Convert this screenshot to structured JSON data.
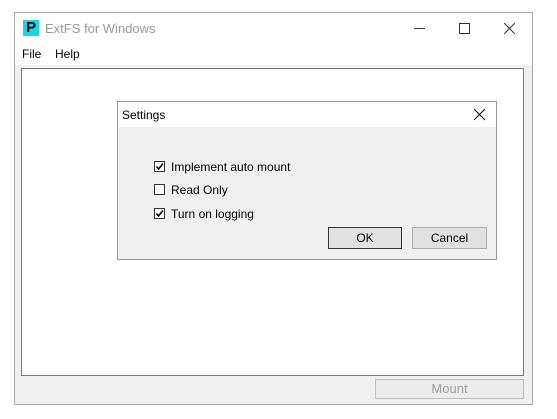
{
  "window": {
    "title": "ExtFS for Windows",
    "icon_glyph": "P",
    "icon_color": "#19d3e6"
  },
  "menu": {
    "file": "File",
    "help": "Help"
  },
  "dialog": {
    "title": "Settings",
    "options": [
      {
        "label": "Implement auto mount",
        "checked": true
      },
      {
        "label": "Read Only",
        "checked": false
      },
      {
        "label": "Turn on logging",
        "checked": true
      }
    ],
    "ok_label": "OK",
    "cancel_label": "Cancel"
  },
  "mount_button": {
    "label": "Mount",
    "enabled": false
  }
}
